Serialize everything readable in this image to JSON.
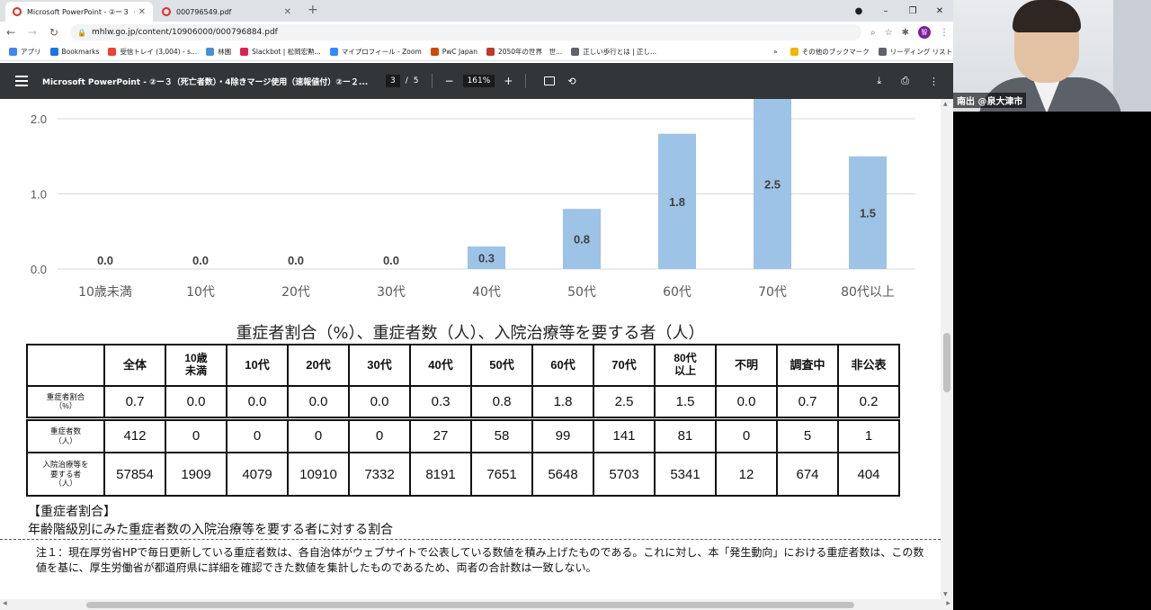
{
  "browser": {
    "tabs": [
      {
        "title": "Microsoft PowerPoint - ②ー３（",
        "close": "✕",
        "favicon_color": "#d93025"
      },
      {
        "title": "000796549.pdf",
        "close": "✕",
        "favicon_color": "#d93025"
      }
    ],
    "new_tab": "+",
    "window_buttons": [
      "●",
      "–",
      "❐",
      "✕"
    ],
    "url": "mhlw.go.jp/content/10906000/000796884.pdf",
    "profile_initial": "智",
    "bookmarks": [
      {
        "label": "アプリ",
        "color": "#4285f4"
      },
      {
        "label": "Bookmarks",
        "color": "#1a73e8"
      },
      {
        "label": "受信トレイ (3,004) - s...",
        "color": "#ea4335"
      },
      {
        "label": "林園",
        "color": "#4a90d9"
      },
      {
        "label": "Slackbot | 松岡宏勲...",
        "color": "#e01e5a"
      },
      {
        "label": "マイプロフィール - Zoom",
        "color": "#2d8cff"
      },
      {
        "label": "PwC Japan",
        "color": "#d04a02"
      },
      {
        "label": "2050年の世界　世...",
        "color": "#c0392b"
      },
      {
        "label": "正しい歩行とは | 正し...",
        "color": "#5f6368"
      },
      {
        "label": "»",
        "color": ""
      },
      {
        "label": "その他のブックマーク",
        "color": "#f4b400"
      },
      {
        "label": "リーディング リスト",
        "color": "#5f6368"
      }
    ]
  },
  "pdf": {
    "title": "Microsoft PowerPoint - ②ー３（死亡者数）・4除きマージ使用（速報値付）②ー２...",
    "page_current": "3",
    "page_sep": "/",
    "page_total": "5",
    "zoom": "161%"
  },
  "chart_data": {
    "type": "bar",
    "categories": [
      "10歳未満",
      "10代",
      "20代",
      "30代",
      "40代",
      "50代",
      "60代",
      "70代",
      "80代以上"
    ],
    "values": [
      0.0,
      0.0,
      0.0,
      0.0,
      0.3,
      0.8,
      1.8,
      2.5,
      1.5
    ],
    "value_labels": [
      "0.0",
      "0.0",
      "0.0",
      "0.0",
      "0.3",
      "0.8",
      "1.8",
      "2.5",
      "1.5"
    ],
    "y_ticks": [
      "0.0",
      "1.0",
      "2.0"
    ],
    "ylim": [
      0,
      2.5
    ],
    "bar_color": "#9dc3e6",
    "grid": true
  },
  "table": {
    "title": "重症者割合（%）、重症者数（人）、入院治療等を要する者（人）",
    "headers": [
      "",
      "全体",
      "10歳\n未満",
      "10代",
      "20代",
      "30代",
      "40代",
      "50代",
      "60代",
      "70代",
      "80代\n以上",
      "不明",
      "調査中",
      "非公表"
    ],
    "rows": [
      {
        "label": "重症者割合\n（%）",
        "values": [
          "0.7",
          "0.0",
          "0.0",
          "0.0",
          "0.0",
          "0.3",
          "0.8",
          "1.8",
          "2.5",
          "1.5",
          "0.0",
          "0.7",
          "0.2"
        ]
      },
      {
        "label": "重症者数\n（人）",
        "values": [
          "412",
          "0",
          "0",
          "0",
          "0",
          "27",
          "58",
          "99",
          "141",
          "81",
          "0",
          "5",
          "1"
        ]
      },
      {
        "label": "入院治療等を\n要する者\n（人）",
        "values": [
          "57854",
          "1909",
          "4079",
          "10910",
          "7332",
          "8191",
          "7651",
          "5648",
          "5703",
          "5341",
          "12",
          "674",
          "404"
        ]
      }
    ]
  },
  "notes": {
    "heading": "【重症者割合】",
    "subheading": "年齢階級別にみた重症者数の入院治療等を要する者に対する割合",
    "note1": "注１：現在厚労省HPで毎日更新している重症者数は、各自治体がウェブサイトで公表している数値を積み上げたものである。これに対し、本「発生動向」における重症者数は、この数値を基に、厚生労働省が都道府県に詳細を確認できた数値を集計したものであるため、両者の合計数は一致しない。"
  },
  "video": {
    "name": "南出 @泉大津市"
  }
}
